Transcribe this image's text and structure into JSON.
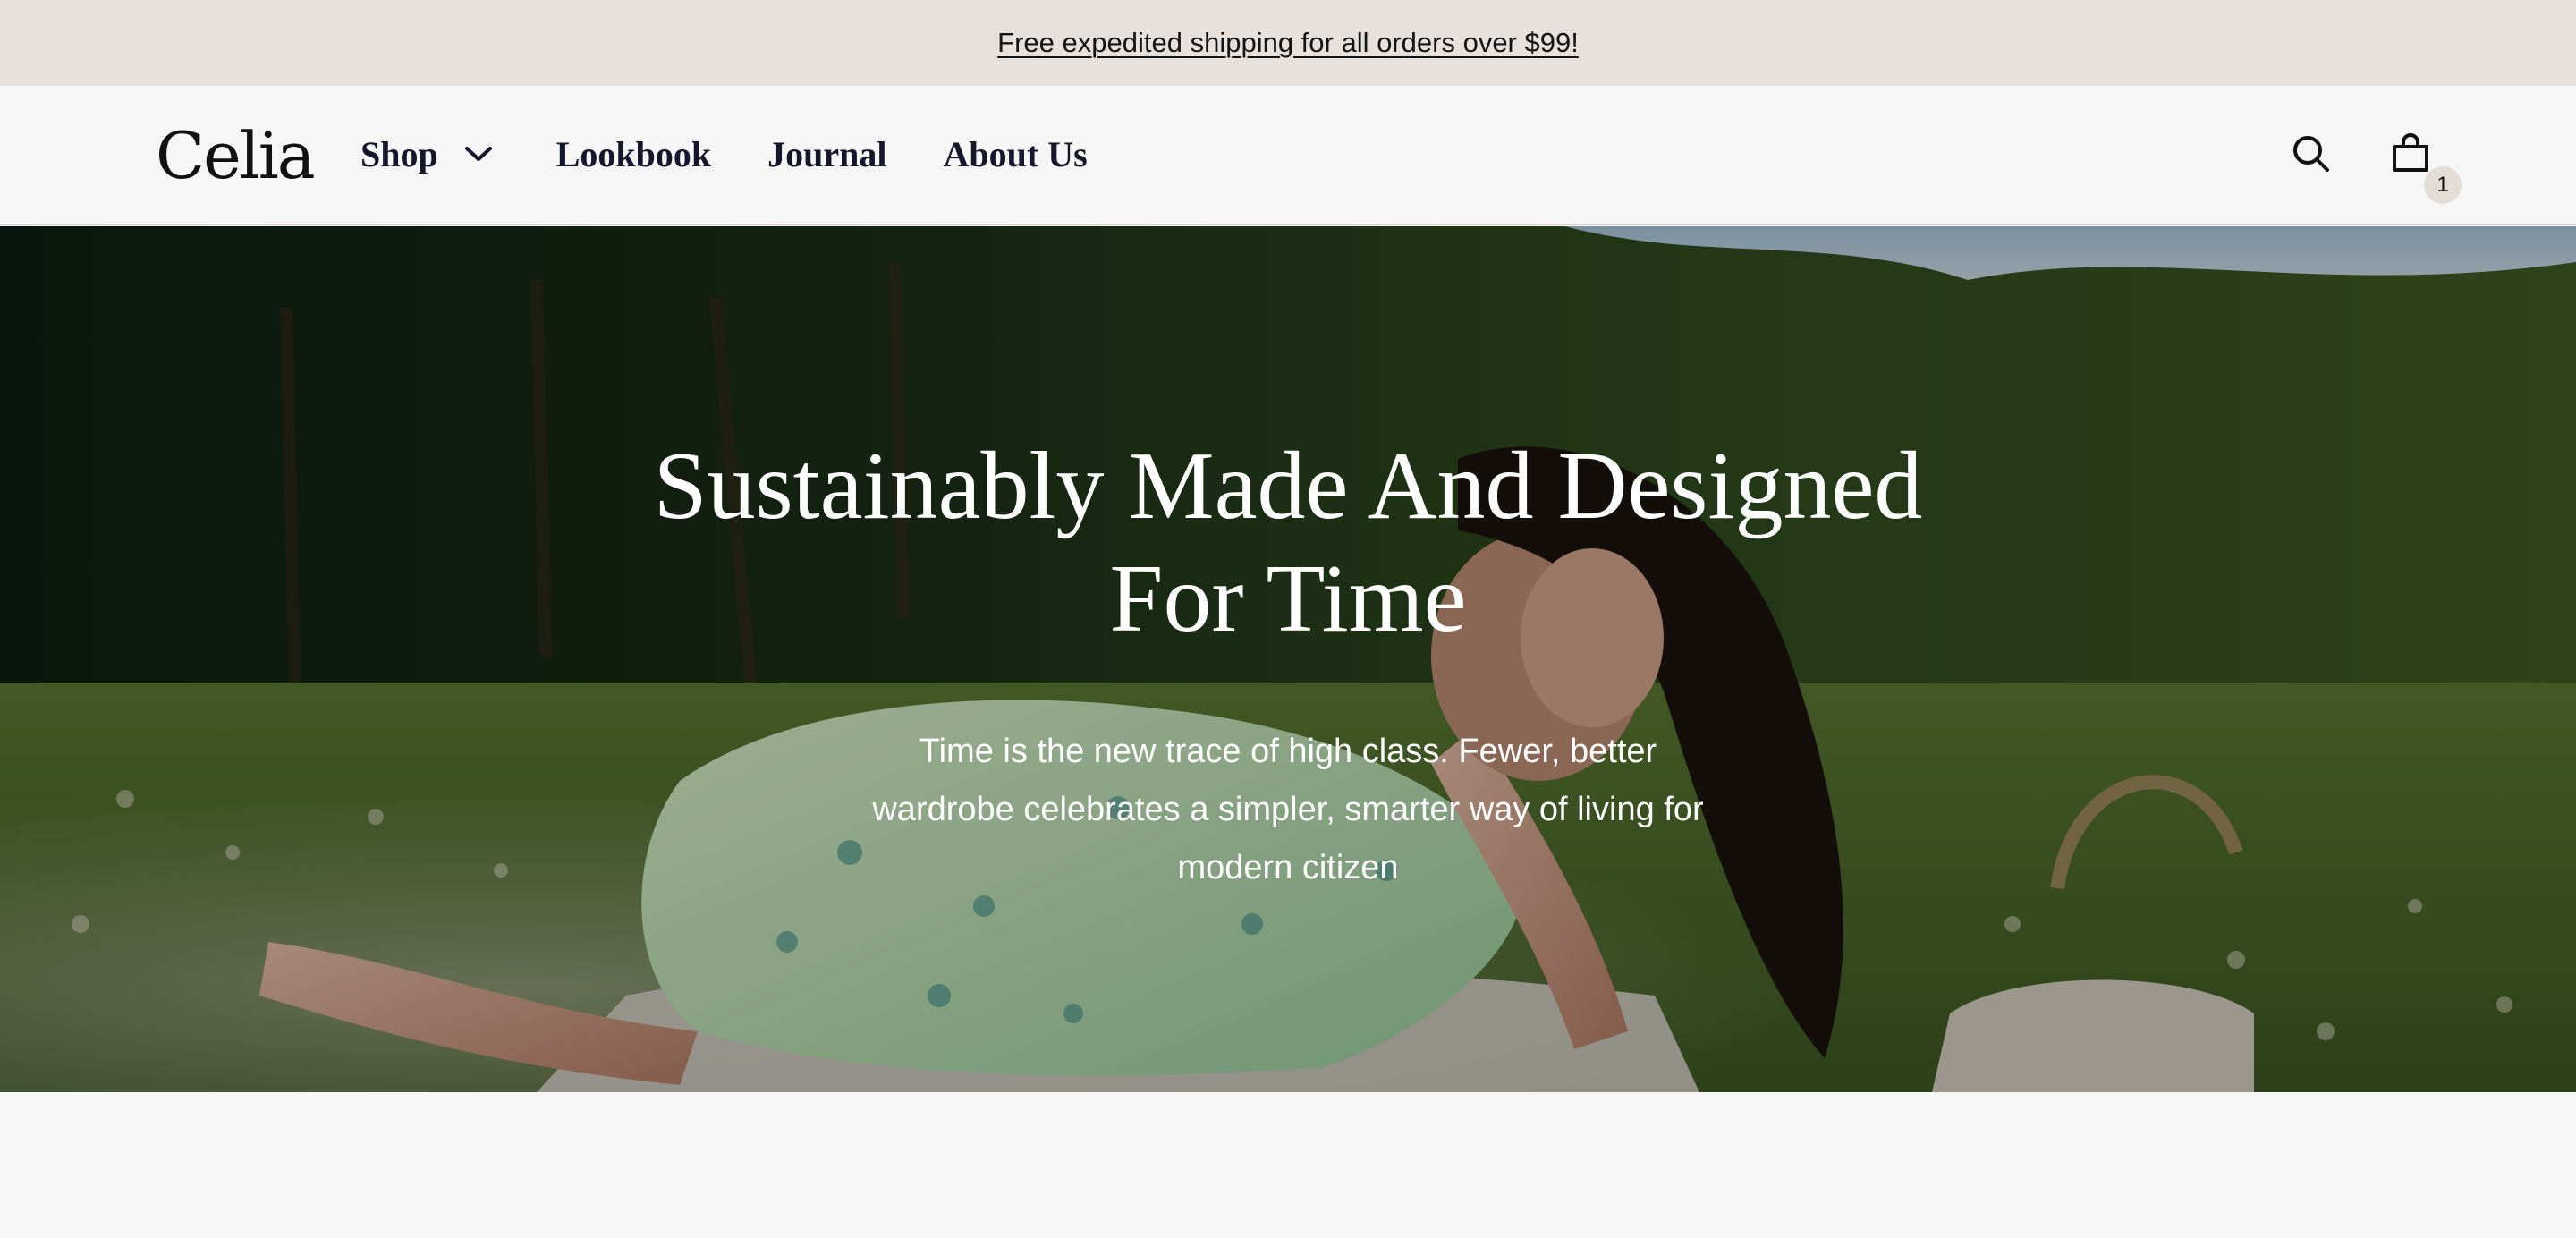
{
  "announcement": {
    "text": "Free expedited shipping for all orders over $99!"
  },
  "header": {
    "logo": "Celia",
    "nav": [
      {
        "label": "Shop",
        "has_dropdown": true
      },
      {
        "label": "Lookbook"
      },
      {
        "label": "Journal"
      },
      {
        "label": "About Us"
      }
    ],
    "cart_count": "1",
    "icons": [
      "search-icon",
      "cart-icon",
      "chevron-down-icon"
    ]
  },
  "hero": {
    "title_line1": "Sustainably Made And Designed",
    "title_line2": "For Time",
    "subtitle_line1": "Time is the new trace of high class. Fewer, better",
    "subtitle_line2": "wardrobe celebrates a simpler, smarter way of living for",
    "subtitle_line3": "modern citizen"
  },
  "colors": {
    "announcement_bg": "#e8e1db",
    "header_bg": "#f6f6f6",
    "nav_text": "#15172b",
    "badge_bg": "#e4ddd6",
    "hero_text": "#ffffff"
  }
}
